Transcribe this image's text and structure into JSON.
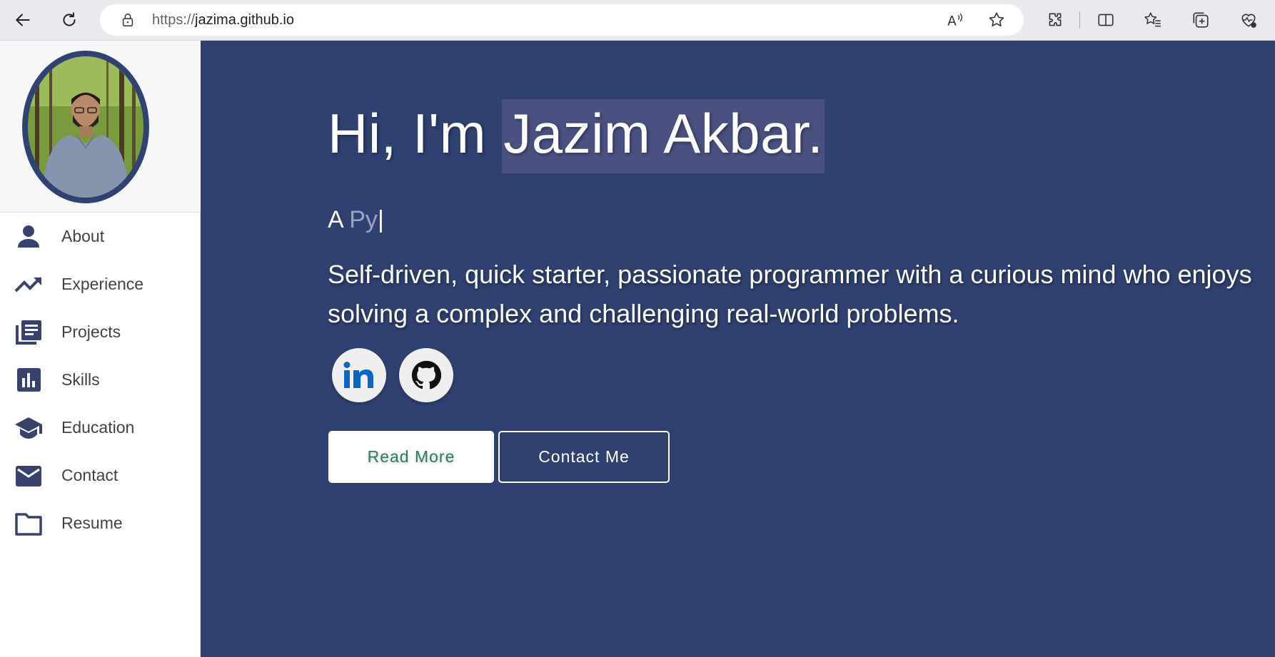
{
  "browser": {
    "url_protocol": "https://",
    "url_host": "jazima.github.io",
    "icons": [
      "back-icon",
      "refresh-icon",
      "lock-icon",
      "read-aloud-icon",
      "favorite-star-icon",
      "extensions-icon",
      "split-screen-icon",
      "favorites-icon",
      "collections-icon",
      "browser-essentials-icon"
    ]
  },
  "sidebar": {
    "items": [
      {
        "label": "About",
        "icon": "person-icon"
      },
      {
        "label": "Experience",
        "icon": "trending-up-icon"
      },
      {
        "label": "Projects",
        "icon": "library-books-icon"
      },
      {
        "label": "Skills",
        "icon": "bar-chart-icon"
      },
      {
        "label": "Education",
        "icon": "graduation-cap-icon"
      },
      {
        "label": "Contact",
        "icon": "mail-icon"
      },
      {
        "label": "Resume",
        "icon": "folder-icon"
      }
    ]
  },
  "hero": {
    "greeting_prefix": "Hi, I'm ",
    "name": "Jazim Akbar.",
    "typed_prefix": "A ",
    "typed_partial": "Py",
    "typed_cursor": "|",
    "intro": "Self-driven, quick starter, passionate programmer with a curious mind who enjoys solving a complex and challenging real-world problems.",
    "read_more": "Read More",
    "contact_me": "Contact Me"
  },
  "colors": {
    "hero_bg": "#304171",
    "nav_icon": "#39426d",
    "avatar_border": "#2f4273",
    "name_highlight": "#4a5180",
    "linkedin": "#0a66c2"
  }
}
